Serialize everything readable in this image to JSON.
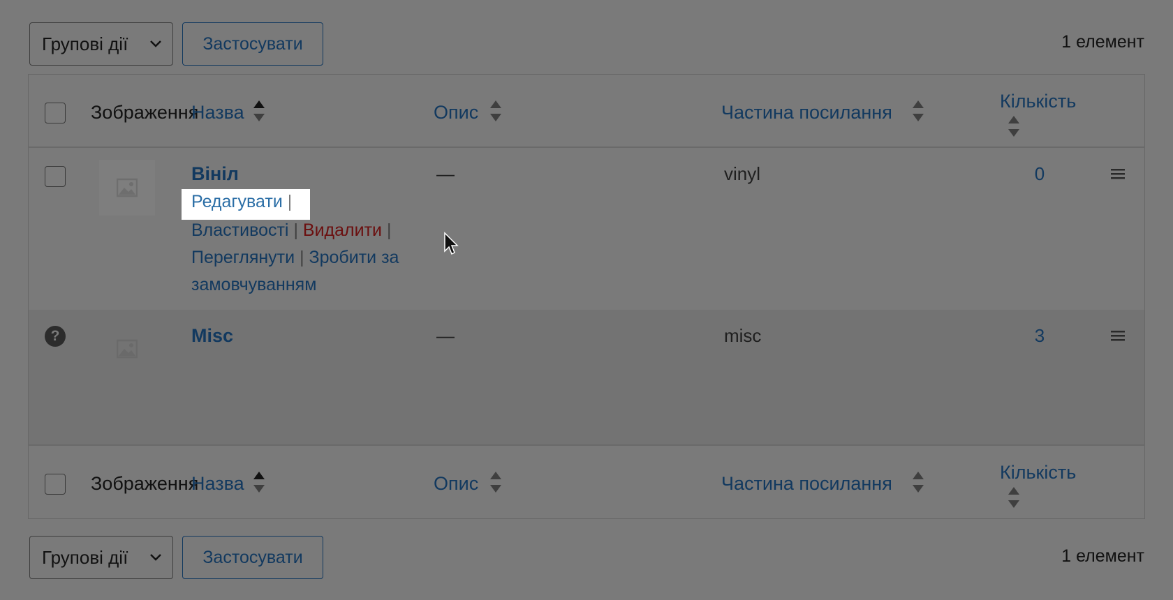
{
  "toolbar_top": {
    "bulk_actions": "Групові дії",
    "apply": "Застосувати",
    "items_count": "1 елемент"
  },
  "toolbar_bottom": {
    "bulk_actions": "Групові дії",
    "apply": "Застосувати",
    "items_count": "1 елемент"
  },
  "columns": {
    "image": "Зображення",
    "name": "Назва",
    "description": "Опис",
    "slug": "Частина посилання",
    "count": "Кількість"
  },
  "rows": [
    {
      "name": "Вініл",
      "description": "—",
      "slug": "vinyl",
      "count": "0",
      "actions": {
        "edit": "Редагувати",
        "properties": "Властивості",
        "delete": "Видалити",
        "view": "Переглянути",
        "make_default": "Зробити за замовчуванням",
        "separator": "|"
      }
    },
    {
      "name": "Misc",
      "description": "—",
      "slug": "misc",
      "count": "3",
      "help_icon": "?"
    }
  ],
  "colors": {
    "link": "#12395f",
    "delete": "#6b0f0f",
    "overlay": "#7a7a7a",
    "highlight": "#ffffff"
  },
  "icons": [
    "chevron-down-icon",
    "sort-arrows-icon",
    "image-placeholder-icon",
    "drag-handle-icon",
    "help-icon",
    "mouse-cursor-icon"
  ]
}
